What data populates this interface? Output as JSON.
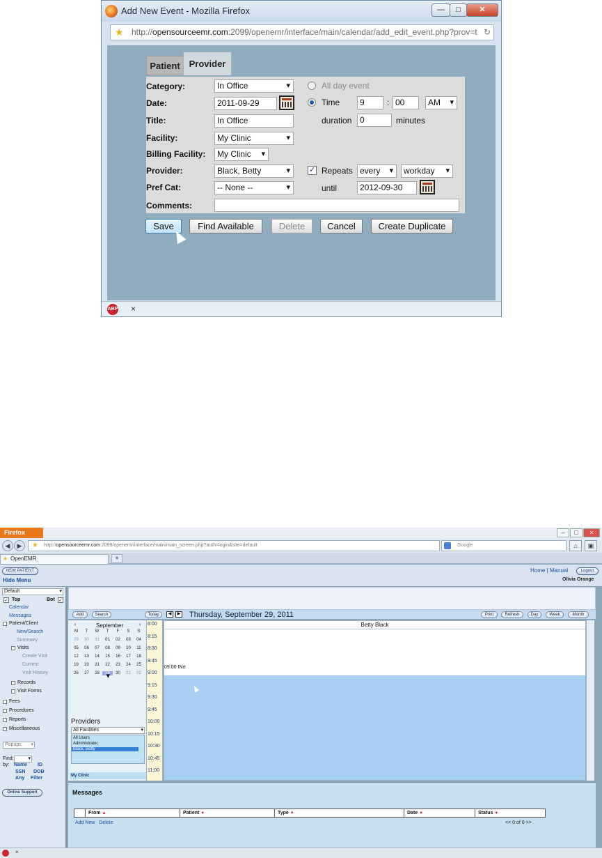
{
  "popup": {
    "window_title": "Add New Event - Mozilla Firefox",
    "url_prefix": "http://",
    "url_host": "opensourceemr.com",
    "url_rest": ":2099/openemr/interface/main/calendar/add_edit_event.php?prov=t",
    "win_buttons": {
      "minimize": "—",
      "maximize": "□",
      "close": "✕"
    },
    "tabs": [
      {
        "label": "Patient"
      },
      {
        "label": "Provider"
      }
    ],
    "active_tab": "Provider",
    "form": {
      "category_label": "Category:",
      "category_value": "In Office",
      "date_label": "Date:",
      "date_value": "2011-09-29",
      "title_label": "Title:",
      "title_value": "In Office",
      "facility_label": "Facility:",
      "facility_value": "My Clinic",
      "billing_facility_label": "Billing Facility:",
      "billing_facility_value": "My Clinic",
      "provider_label": "Provider:",
      "provider_value": "Black, Betty",
      "pref_cat_label": "Pref Cat:",
      "pref_cat_value": "-- None --",
      "comments_label": "Comments:",
      "comments_value": "",
      "all_day_label": "All day event",
      "time_label": "Time",
      "hour_value": "9",
      "minute_value": "00",
      "ampm_value": "AM",
      "time_sep": ":",
      "duration_label": "duration",
      "duration_value": "0",
      "minutes_label": "minutes",
      "repeats_label": "Repeats",
      "repeats_checked": true,
      "repeat_every": "every",
      "repeat_unit": "workday",
      "until_label": "until",
      "until_value": "2012-09-30"
    },
    "buttons": {
      "save": "Save",
      "find_available": "Find Available",
      "delete": "Delete",
      "cancel": "Cancel",
      "create_duplicate": "Create Duplicate"
    },
    "status_abp": "ABP",
    "status_x": "×"
  },
  "browser": {
    "menu": "Firefox",
    "url_prefix": "http://",
    "url_host": "opensourceemr.com",
    "url_rest": ":2099/openemr/interface/main/main_screen.php?auth=login&site=default",
    "search_engine": "Google",
    "tab_title": "OpenEMR",
    "new_tab": "+"
  },
  "emr": {
    "new_patient": "NEW PATIENT",
    "hide_menu": "Hide Menu",
    "home": "Home",
    "sep": "|",
    "manual": "Manual",
    "logout": "Logout",
    "user": "Olivia Orange",
    "nav": {
      "mode_select": "Default",
      "top": "Top",
      "bot": "Bot",
      "calendar": "Calendar",
      "messages": "Messages",
      "patient_client": "Patient/Client",
      "new_search": "New/Search",
      "summary": "Summary",
      "visits": "Visits",
      "create_visit": "Create Visit",
      "current": "Current",
      "visit_history": "Visit History",
      "records": "Records",
      "visit_forms": "Visit Forms",
      "fees": "Fees",
      "procedures": "Procedures",
      "reports": "Reports",
      "miscellaneous": "Miscellaneous",
      "popups": "Popups",
      "find": "Find:",
      "by": "by:",
      "name": "Name",
      "id": "ID",
      "ssn": "SSN",
      "dob": "DOB",
      "any": "Any",
      "filter": "Filter",
      "online_support": "Online Support"
    },
    "calendar": {
      "add": "Add",
      "search": "Search",
      "today": "Today",
      "prev": "◀",
      "next": "▶",
      "date_title": "Thursday, September 29, 2011",
      "print": "Print",
      "refresh": "Refresh",
      "day": "Day",
      "week": "Week",
      "month": "Month",
      "month_name": "September",
      "weekday_heads": [
        "M",
        "T",
        "W",
        "T",
        "F",
        "S",
        "S"
      ],
      "weeks": [
        [
          "29",
          "30",
          "31",
          "01",
          "02",
          "03",
          "04"
        ],
        [
          "05",
          "06",
          "07",
          "08",
          "09",
          "10",
          "11"
        ],
        [
          "12",
          "13",
          "14",
          "15",
          "16",
          "17",
          "18"
        ],
        [
          "19",
          "20",
          "21",
          "22",
          "23",
          "24",
          "25"
        ],
        [
          "26",
          "27",
          "28",
          "29",
          "30",
          "01",
          "02"
        ]
      ],
      "selected_day": "29",
      "providers_title": "Providers",
      "facilities_select": "All Facilities",
      "provider_list": [
        "All Users",
        "Administrator,",
        "Black, Betty"
      ],
      "selected_provider": "Black, Betty",
      "clinic": "My Clinic",
      "column_header": "Betty Black",
      "times": [
        "8:00",
        "8:15",
        "8:30",
        "8:45",
        "9:00",
        "9:15",
        "9:30",
        "9:45",
        "10:00",
        "10:15",
        "10:30",
        "10:45",
        "11:00"
      ],
      "event_text": "09:00 IN"
    },
    "messages": {
      "title": "Messages",
      "columns": [
        "From",
        "Patient",
        "Type",
        "Date",
        "Status"
      ],
      "add_new": "Add New",
      "delete": "Delete",
      "pager": "<<  0 of 0  >>"
    }
  }
}
